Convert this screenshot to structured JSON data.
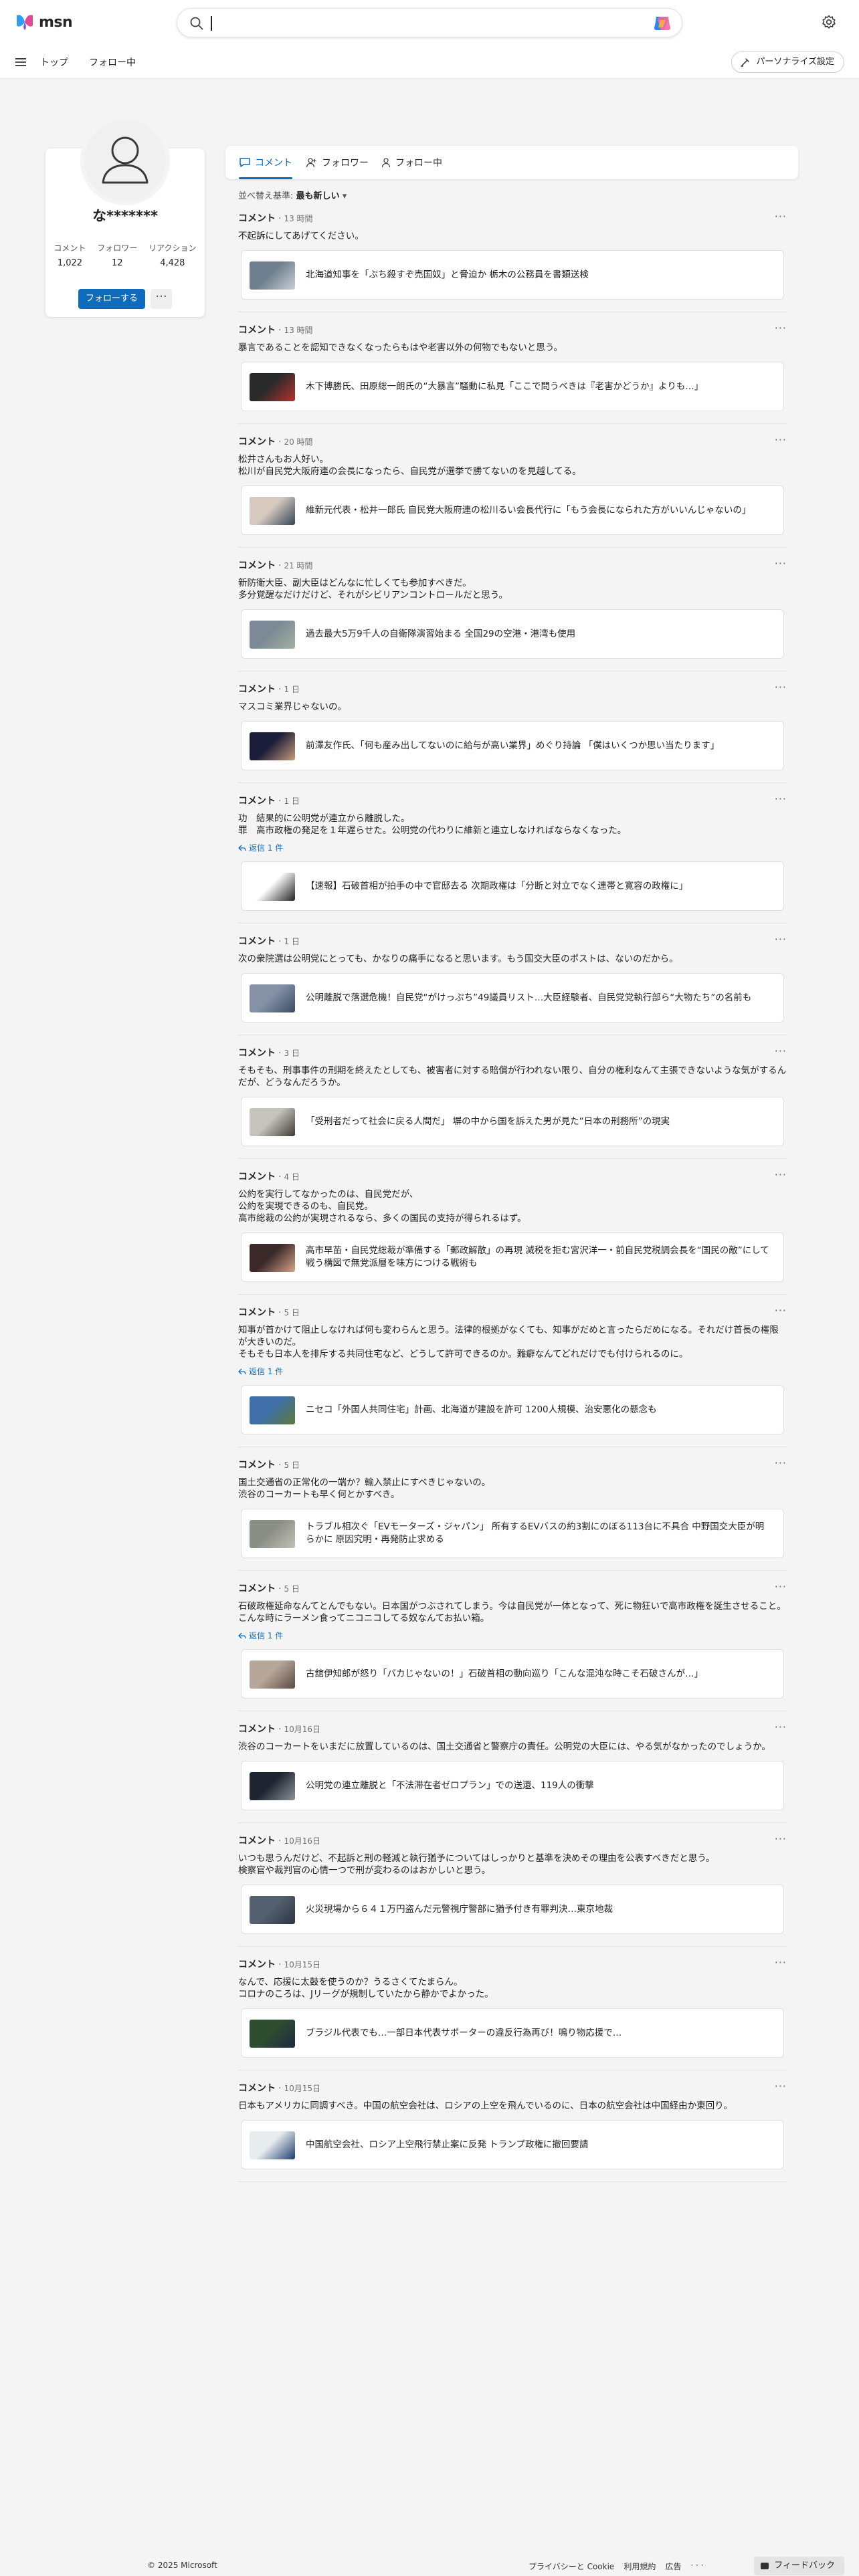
{
  "header": {
    "logo_text": "msn",
    "search_placeholder": ""
  },
  "nav": {
    "home": "トップ",
    "following": "フォロー中",
    "personalize": "パーソナライズ設定"
  },
  "profile": {
    "name": "な*******",
    "stats": [
      {
        "label": "コメント",
        "value": "1,022"
      },
      {
        "label": "フォロワー",
        "value": "12"
      },
      {
        "label": "リアクション",
        "value": "4,428"
      }
    ],
    "follow_label": "フォローする",
    "more_label": "···"
  },
  "tabs": [
    {
      "label": "コメント"
    },
    {
      "label": "フォロワー"
    },
    {
      "label": "フォロー中"
    }
  ],
  "sort": {
    "prefix": "並べ替え基準:",
    "value": "最も新しい"
  },
  "comment_label": "コメント",
  "reply_label": "返信 1 件",
  "comments": [
    {
      "time": "13 時間",
      "text": "不起訴にしてあげてください。",
      "article": "北海道知事を「ぶち殺すぞ売国奴」と脅迫か 栃木の公務員を書類送検",
      "reply": false,
      "thumb": [
        "#6f7f8f",
        "#c9cfd6"
      ]
    },
    {
      "time": "13 時間",
      "text": "暴言であることを認知できなくなったらもはや老害以外の何物でもないと思う。",
      "article": "木下博勝氏、田原総一朗氏の“大暴言”騒動に私見「ここで問うべきは『老害かどうか』よりも…」",
      "reply": false,
      "thumb": [
        "#2a2a2a",
        "#b8322e"
      ]
    },
    {
      "time": "20 時間",
      "text": "松井さんもお人好い。\n松川が自民党大阪府連の会長になったら、自民党が選挙で勝てないのを見越してる。",
      "article": "維新元代表・松井一郎氏 自民党大阪府連の松川るい会長代行に「もう会長になられた方がいいんじゃないの」",
      "reply": false,
      "thumb": [
        "#d8c9bf",
        "#334455"
      ]
    },
    {
      "time": "21 時間",
      "text": "新防衛大臣、副大臣はどんなに忙しくても参加すべきだ。\n多分覚醒なだけだけど、それがシビリアンコントロールだと思う。",
      "article": "過去最大5万9千人の自衛隊演習始まる 全国29の空港・港湾も使用",
      "reply": false,
      "thumb": [
        "#7b8a96",
        "#a3b1a0"
      ]
    },
    {
      "time": "1 日",
      "text": "マスコミ業界じゃないの。",
      "article": "前澤友作氏、「何も産み出してないのに給与が高い業界」めぐり持論 「僕はいくつか思い当たります」",
      "reply": false,
      "thumb": [
        "#1b1d3a",
        "#c89a7a"
      ]
    },
    {
      "time": "1 日",
      "text": "功　結果的に公明党が連立から離脱した。\n罪　高市政権の発足を１年遅らせた。公明党の代わりに維新と連立しなければならなくなった。",
      "article": "【速報】石破首相が拍手の中で官邸去る 次期政権は「分断と対立でなく連帯と寛容の政権に」",
      "reply": true,
      "thumb": [
        "#ffffff",
        "#222222"
      ]
    },
    {
      "time": "1 日",
      "text": "次の衆院選は公明党にとっても、かなりの痛手になると思います。もう国交大臣のポストは、ないのだから。",
      "article": "公明離脱で落選危機！自民党“がけっぷち”49議員リスト…大臣経験者、自民党党執行部ら“大物たち”の名前も",
      "reply": false,
      "thumb": [
        "#8592a6",
        "#3b4b63"
      ]
    },
    {
      "time": "3 日",
      "text": "そもそも、刑事事件の刑期を終えたとしても、被害者に対する賠償が行われない限り、自分の権利なんて主張できないような気がするんだが、どうなんだろうか。",
      "article": "「受刑者だって社会に戻る人間だ」 塀の中から国を訴えた男が見た“日本の刑務所”の現実",
      "reply": false,
      "thumb": [
        "#c7c3bd",
        "#3f3a36"
      ]
    },
    {
      "time": "4 日",
      "text": "公約を実行してなかったのは、自民党だが、\n公約を実現できるのも、自民党。\n高市総裁の公約が実現されるなら、多くの国民の支持が得られるはず。",
      "article": "高市早苗・自民党総裁が準備する「郵政解散」の再現 減税を拒む宮沢洋一・前自民党税調会長を“国民の敵”にして戦う構図で無党派層を味方につける戦術も",
      "reply": false,
      "thumb": [
        "#3c2a2a",
        "#d7a38a"
      ]
    },
    {
      "time": "5 日",
      "text": "知事が首かけて阻止しなければ何も変わらんと思う。法律的根拠がなくても、知事がだめと言ったらだめになる。それだけ首長の権限が大きいのだ。\nそもそも日本人を排斥する共同住宅など、どうして許可できるのか。難癖なんてどれだけでも付けられるのに。",
      "article": "ニセコ「外国人共同住宅」計画、北海道が建設を許可 1200人規模、治安悪化の懸念も",
      "reply": true,
      "thumb": [
        "#3e6fa8",
        "#5c7a3a"
      ]
    },
    {
      "time": "5 日",
      "text": "国土交通省の正常化の一端か？輸入禁止にすべきじゃないの。\n渋谷のコーカートも早く何とかすべき。",
      "article": "トラブル相次ぐ「EVモーターズ・ジャパン」 所有するEVバスの約3割にのぼる113台に不具合 中野国交大臣が明らかに 原因究明・再発防止求める",
      "reply": false,
      "thumb": [
        "#8a8f86",
        "#c4c0b5"
      ]
    },
    {
      "time": "5 日",
      "text": "石破政権延命なんてとんでもない。日本国がつぶされてしまう。今は自民党が一体となって、死に物狂いで高市政権を誕生させること。こんな時にラーメン食ってニコニコしてる奴なんてお払い箱。",
      "article": "古舘伊知郎が怒り「バカじゃないの！」石破首相の動向巡り「こんな混沌な時こそ石破さんが…」",
      "reply": true,
      "thumb": [
        "#b7a79a",
        "#5a4b43"
      ]
    },
    {
      "time": "10月16日",
      "text": "渋谷のコーカートをいまだに放置しているのは、国土交通省と警察庁の責任。公明党の大臣には、やる気がなかったのでしょうか。",
      "article": "公明党の連立離脱と「不法滞在者ゼロプラン」での送還、119人の衝撃",
      "reply": false,
      "thumb": [
        "#1f2530",
        "#8e9299"
      ]
    },
    {
      "time": "10月16日",
      "text": "いつも思うんだけど、不起訴と刑の軽減と執行猶予についてはしっかりと基準を決めその理由を公表すべきだと思う。\n検察官や裁判官の心情一つで刑が変わるのはおかしいと思う。",
      "article": "火災現場から６４１万円盗んだ元警視庁警部に猶予付き有罪判決…東京地裁",
      "reply": false,
      "thumb": [
        "#556070",
        "#2c3540"
      ]
    },
    {
      "time": "10月15日",
      "text": "なんで、応援に太鼓を使うのか？うるさくてたまらん。\nコロナのころは、Jリーグが規制していたから静かでよかった。",
      "article": "ブラジル代表でも…一部日本代表サポーターの違反行為再び！鳴り物応援で…",
      "reply": false,
      "thumb": [
        "#2f4d2f",
        "#1c2a40"
      ]
    },
    {
      "time": "10月15日",
      "text": "日本もアメリカに同調すべき。中国の航空会社は、ロシアの上空を飛んでいるのに、日本の航空会社は中国経由か東回り。",
      "article": "中国航空会社、ロシア上空飛行禁止案に反発 トランプ政権に撤回要請",
      "reply": false,
      "thumb": [
        "#e7ecef",
        "#1e3d6e"
      ]
    }
  ],
  "footer": {
    "copyright": "© 2025 Microsoft",
    "links": [
      "プライバシーと Cookie",
      "利用規約",
      "広告",
      "· · ·"
    ],
    "feedback": "フィードバック"
  }
}
